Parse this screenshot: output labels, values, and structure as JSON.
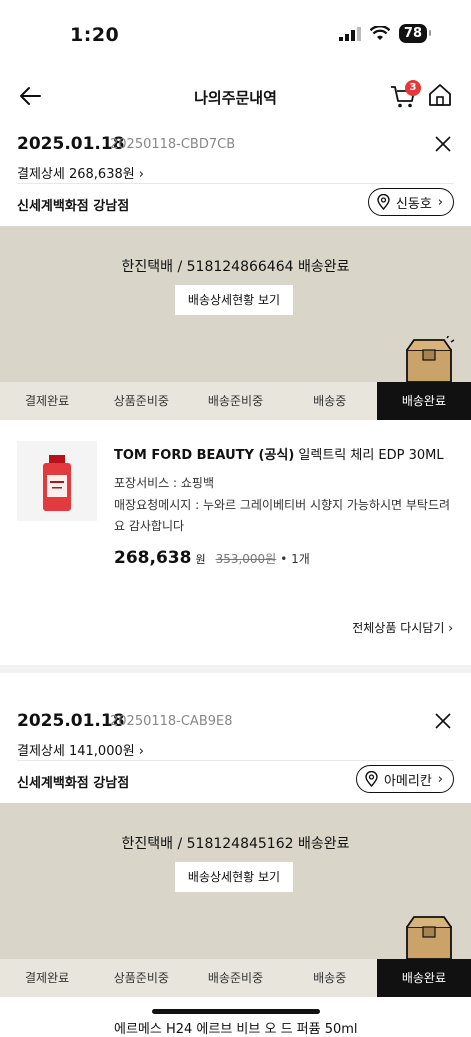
{
  "status": {
    "time": "1:20",
    "battery": "78"
  },
  "header": {
    "title": "나의주문내역",
    "cart_count": "3"
  },
  "orders": [
    {
      "date": "2025.01.18",
      "order_no": "20250118-CBD7CB",
      "pay_detail": "결제상세 268,638원",
      "store": "신세계백화점 강남점",
      "pickup_person": "신동호",
      "shipping_text": "한진택배 / 518124866464 배송완료",
      "shipping_button": "배송상세현황 보기",
      "steps": [
        "결제완료",
        "상품준비중",
        "배송준비중",
        "배송중",
        "배송완료"
      ],
      "product": {
        "brand": "TOM FORD BEAUTY (공식)",
        "name": "일렉트릭 체리 EDP 30ML",
        "pack_service": "포장서비스 : 쇼핑백",
        "request": "매장요청메시지 : 누와르 그레이베티버 시향지 가능하시면 부탁드려요 감사합니다",
        "price": "268,638",
        "won": "원",
        "orig_price": "353,000원",
        "qty": "• 1개"
      },
      "cart_again": "전체상품 다시담기"
    },
    {
      "date": "2025.01.18",
      "order_no": "20250118-CAB9E8",
      "pay_detail": "결제상세 141,000원",
      "store": "신세계백화점 강남점",
      "pickup_person": "아메리칸",
      "shipping_text": "한진택배 / 518124845162 배송완료",
      "shipping_button": "배송상세현황 보기",
      "steps": [
        "결제완료",
        "상품준비중",
        "배송준비중",
        "배송중",
        "배송완료"
      ],
      "partial_product": "에르메스 H24 에르브 비브 오 드 퍼퓸 50ml"
    }
  ]
}
